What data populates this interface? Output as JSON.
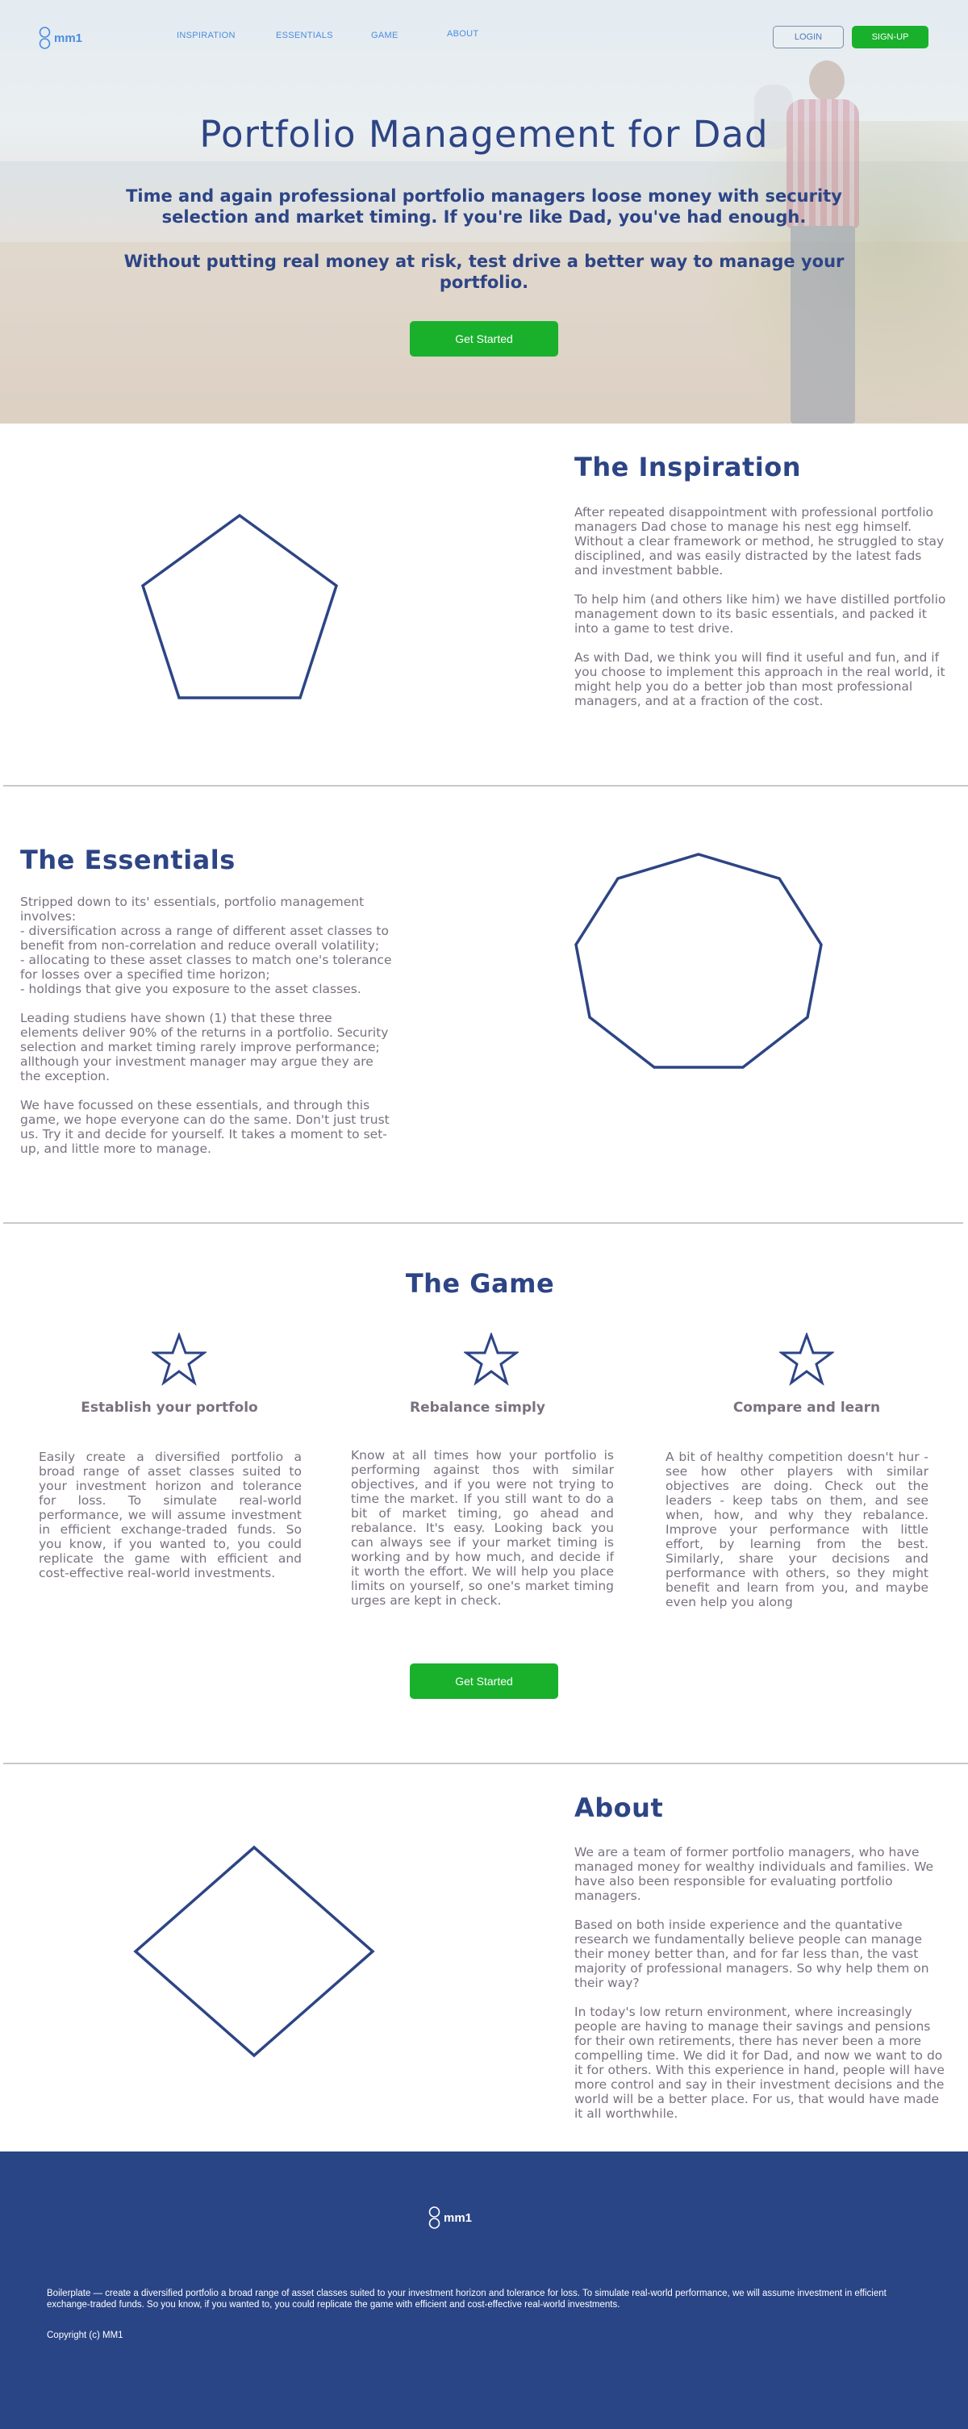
{
  "brand": {
    "name": "mm1",
    "logo_icon": "person-icon",
    "accent": "#2d4585",
    "cta_green": "#19b12c",
    "link_blue": "#4a8de0"
  },
  "nav": {
    "links": [
      "INSPIRATION",
      "ESSENTIALS",
      "GAME",
      "ABOUT"
    ],
    "login_label": "LOGIN",
    "signup_label": "SIGN-UP"
  },
  "hero": {
    "title": "Portfolio Management for Dad",
    "subtitle_1": "Time and again professional portfolio managers loose money with security selection and market timing.  If you're like Dad, you've had enough.",
    "subtitle_2": "Without putting real money at risk, test drive a better way to manage your portfolio.",
    "cta_label": "Get Started",
    "background_image": "father-carrying-child-on-beach"
  },
  "inspiration": {
    "title": "The Inspiration",
    "shape_icon": "pentagon-icon",
    "paragraphs": [
      "After repeated disappointment with professional portfolio managers Dad chose to manage his nest egg himself.  Without a clear framework or method, he struggled to stay disciplined, and was easily distracted by the latest fads and investment babble.",
      "To help him (and others like him) we have distilled portfolio management down to its basic essentials, and packed it into a game to test drive.",
      "As with Dad, we think you will find it useful and fun, and if you choose to implement this approach in the real world, it might help you do a better job than most professional managers, and at a fraction of the cost."
    ]
  },
  "essentials": {
    "title": "The Essentials",
    "shape_icon": "nonagon-icon",
    "intro_lines": [
      "Stripped down to its' essentials, portfolio management involves:",
      "- diversification across a range of different asset classes to benefit from non-correlation and reduce overall volatility;",
      "- allocating to these asset classes to match one's tolerance for losses over a specified time horizon;",
      "- holdings that give you exposure to the asset classes."
    ],
    "paragraphs": [
      "Leading studiens have shown (1) that these three elements deliver 90% of the returns in a portfolio. Security selection and market timing rarely improve performance; allthough your investment manager may argue they are the exception.",
      "We  have focussed on these essentials, and through this game, we hope everyone can do the same.  Don't just trust us.  Try it and decide for yourself.  It takes a moment to set-up, and little more to manage."
    ]
  },
  "game": {
    "title": "The Game",
    "features": [
      {
        "icon": "star-icon",
        "title": "Establish your portfolo",
        "text": "Easily create a diversified portfolio a broad range of asset classes suited to your investment horizon and tolerance for loss.  To simulate real-world performance, we will assume investment in efficient exchange-traded funds.   So you know, if you wanted to, you could replicate the game with efficient and cost-effective real-world investments."
      },
      {
        "icon": "star-icon",
        "title": "Rebalance simply",
        "text": "Know at all times how your portfolio is performing against thos with similar objectives, and if you were not trying to time the market.  If you still want to do a bit of market timing, go ahead and rebalance.   It's easy.  Looking back you can always see if your market timing is working and by how much, and decide if it worth the effort.   We will help you place limits on yourself, so one's market timing urges are kept in check."
      },
      {
        "icon": "star-icon",
        "title": "Compare and learn",
        "text": "A bit of healthy competition doesn't hur - see how other players with similar objectives are doing.  Check out the leaders - keep tabs on them, and see when, how, and why they rebalance.  Improve your performance with little effort, by learning from the best.  Similarly, share your decisions and performance with others, so they might benefit and learn from you, and maybe even help you along"
      }
    ],
    "cta_label": "Get Started"
  },
  "about": {
    "title": "About",
    "shape_icon": "diamond-icon",
    "paragraphs": [
      "We are a team of former portfolio managers, who have managed money for wealthy individuals and families.  We have also been responsible for evaluating portfolio managers.",
      "Based on both inside experience and the quantative research we fundamentally believe people can manage their money better than, and for far less than, the vast majority of professional managers.  So why help them on their way?",
      "In today's low return environment, where increasingly people are having to manage their savings and pensions for their own retirements, there has never been a more compelling time.  We did it for Dad, and now we want to do it for others.  With this experience in hand, people will have more control and say in their investment decisions and the world will be a better place.  For us, that would have made it all worthwhile."
    ]
  },
  "footer": {
    "boilerplate": "Boilerplate — create a diversified portfolio a broad range of asset classes suited to your investment horizon and tolerance for loss.  To simulate real-world performance, we will assume investment in efficient exchange-traded funds.   So you know, if you wanted to, you could replicate the game with efficient and cost-effective real-world investments.",
    "copyright": "Copyright (c) MM1"
  }
}
